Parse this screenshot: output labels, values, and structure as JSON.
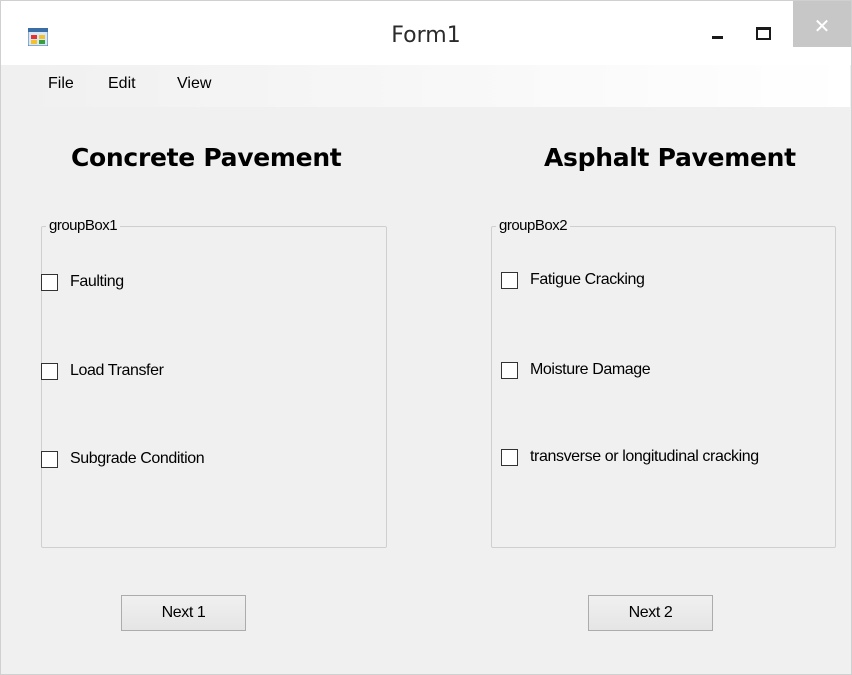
{
  "window": {
    "title": "Form1",
    "close_glyph": "✕",
    "close_color": "#c7c7c7"
  },
  "menu": {
    "file": "File",
    "edit": "Edit",
    "view": "View"
  },
  "concrete": {
    "heading": "Concrete Pavement",
    "group_label": "groupBox1",
    "checkboxes": [
      {
        "label": "Faulting",
        "checked": false
      },
      {
        "label": "Load Transfer",
        "checked": false
      },
      {
        "label": "Subgrade Condition",
        "checked": false
      }
    ],
    "button_label": "Next 1"
  },
  "asphalt": {
    "heading": "Asphalt Pavement",
    "group_label": "groupBox2",
    "checkboxes": [
      {
        "label": "Fatigue Cracking",
        "checked": false
      },
      {
        "label": "Moisture Damage",
        "checked": false
      },
      {
        "label": "transverse or longitudinal cracking",
        "checked": false
      }
    ],
    "button_label": "Next 2"
  },
  "icons": {
    "app": "app-window-icon",
    "minimize": "minimize-icon",
    "maximize": "maximize-icon",
    "close": "close-icon"
  }
}
